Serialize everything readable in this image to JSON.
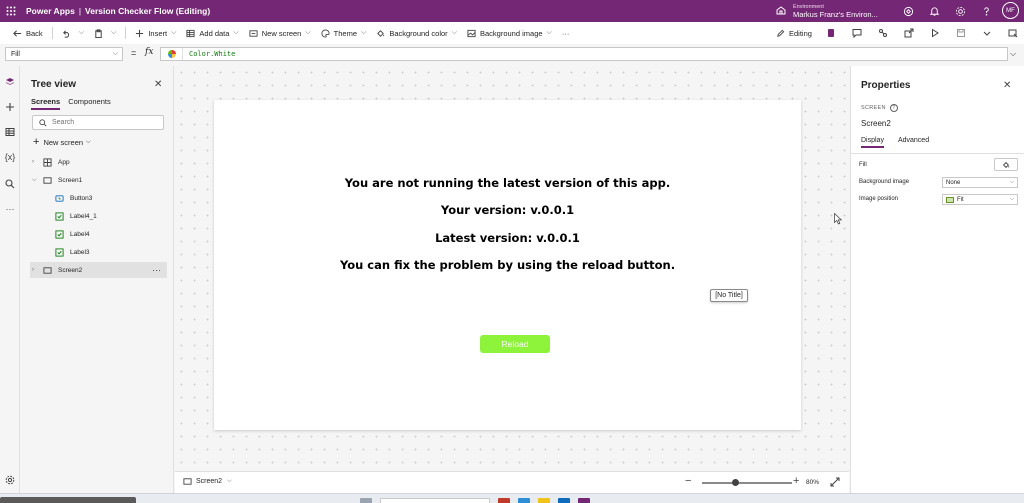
{
  "topbar": {
    "app_name": "Power Apps",
    "separator": "|",
    "app_title": "Version Checker Flow (Editing)",
    "environment_label": "Environment",
    "environment_name": "Markus Franz's Environ...",
    "avatar_initials": "MF"
  },
  "cmdbar": {
    "back": "Back",
    "insert": "Insert",
    "add_data": "Add data",
    "new_screen": "New screen",
    "theme": "Theme",
    "background_color": "Background color",
    "background_image": "Background image",
    "more": "···",
    "editing": "Editing"
  },
  "formula_bar": {
    "property": "Fill",
    "equals": "=",
    "fx": "fx",
    "formula": "Color.White"
  },
  "tree": {
    "title": "Tree view",
    "tabs": [
      "Screens",
      "Components"
    ],
    "search_placeholder": "Search",
    "new_screen": "New screen",
    "nodes": [
      {
        "label": "App"
      },
      {
        "label": "Screen1"
      },
      {
        "label": "Button3"
      },
      {
        "label": "Label4_1"
      },
      {
        "label": "Label4"
      },
      {
        "label": "Label3"
      },
      {
        "label": "Screen2"
      }
    ]
  },
  "canvas": {
    "messages": [
      "You are not running the latest version of this app.",
      "Your version: v.0.0.1",
      "Latest version: v.0.0.1",
      "You can fix the problem by using the reload button."
    ],
    "tooltip": "[No Title]",
    "reload_label": "Reload",
    "reload_color": "#8ef43b"
  },
  "bottombar": {
    "screen_name": "Screen2",
    "zoom": "80%",
    "zoom_level_percent": 80
  },
  "properties": {
    "title": "Properties",
    "kind": "SCREEN",
    "name": "Screen2",
    "tabs": [
      "Display",
      "Advanced"
    ],
    "fill_label": "Fill",
    "bg_image_label": "Background image",
    "bg_image_value": "None",
    "image_position_label": "Image position",
    "image_position_value": "Fit"
  },
  "colors": {
    "brand": "#742774",
    "reload_button": "#8ef43b"
  }
}
